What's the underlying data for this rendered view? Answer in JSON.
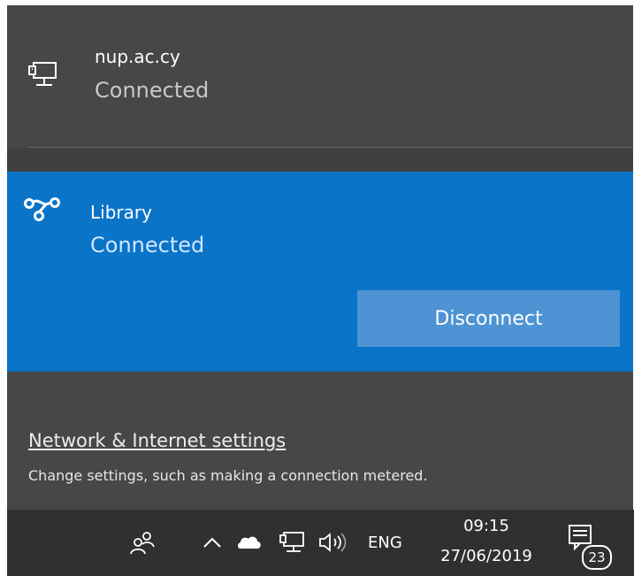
{
  "networks": {
    "ethernet": {
      "name": "nup.ac.cy",
      "status": "Connected",
      "icon": "ethernet-icon"
    },
    "vpn": {
      "name": "Library",
      "status": "Connected",
      "icon": "vpn-icon",
      "action_label": "Disconnect"
    }
  },
  "settings": {
    "link_label": "Network & Internet settings",
    "description": "Change settings, such as making a connection metered."
  },
  "taskbar": {
    "language": "ENG",
    "time": "09:15",
    "date": "27/06/2019",
    "notification_count": "23"
  },
  "colors": {
    "flyout_bg": "#474747",
    "selected_bg": "#0a74c9",
    "button_bg": "#4e93d3",
    "taskbar_bg": "#303030"
  }
}
